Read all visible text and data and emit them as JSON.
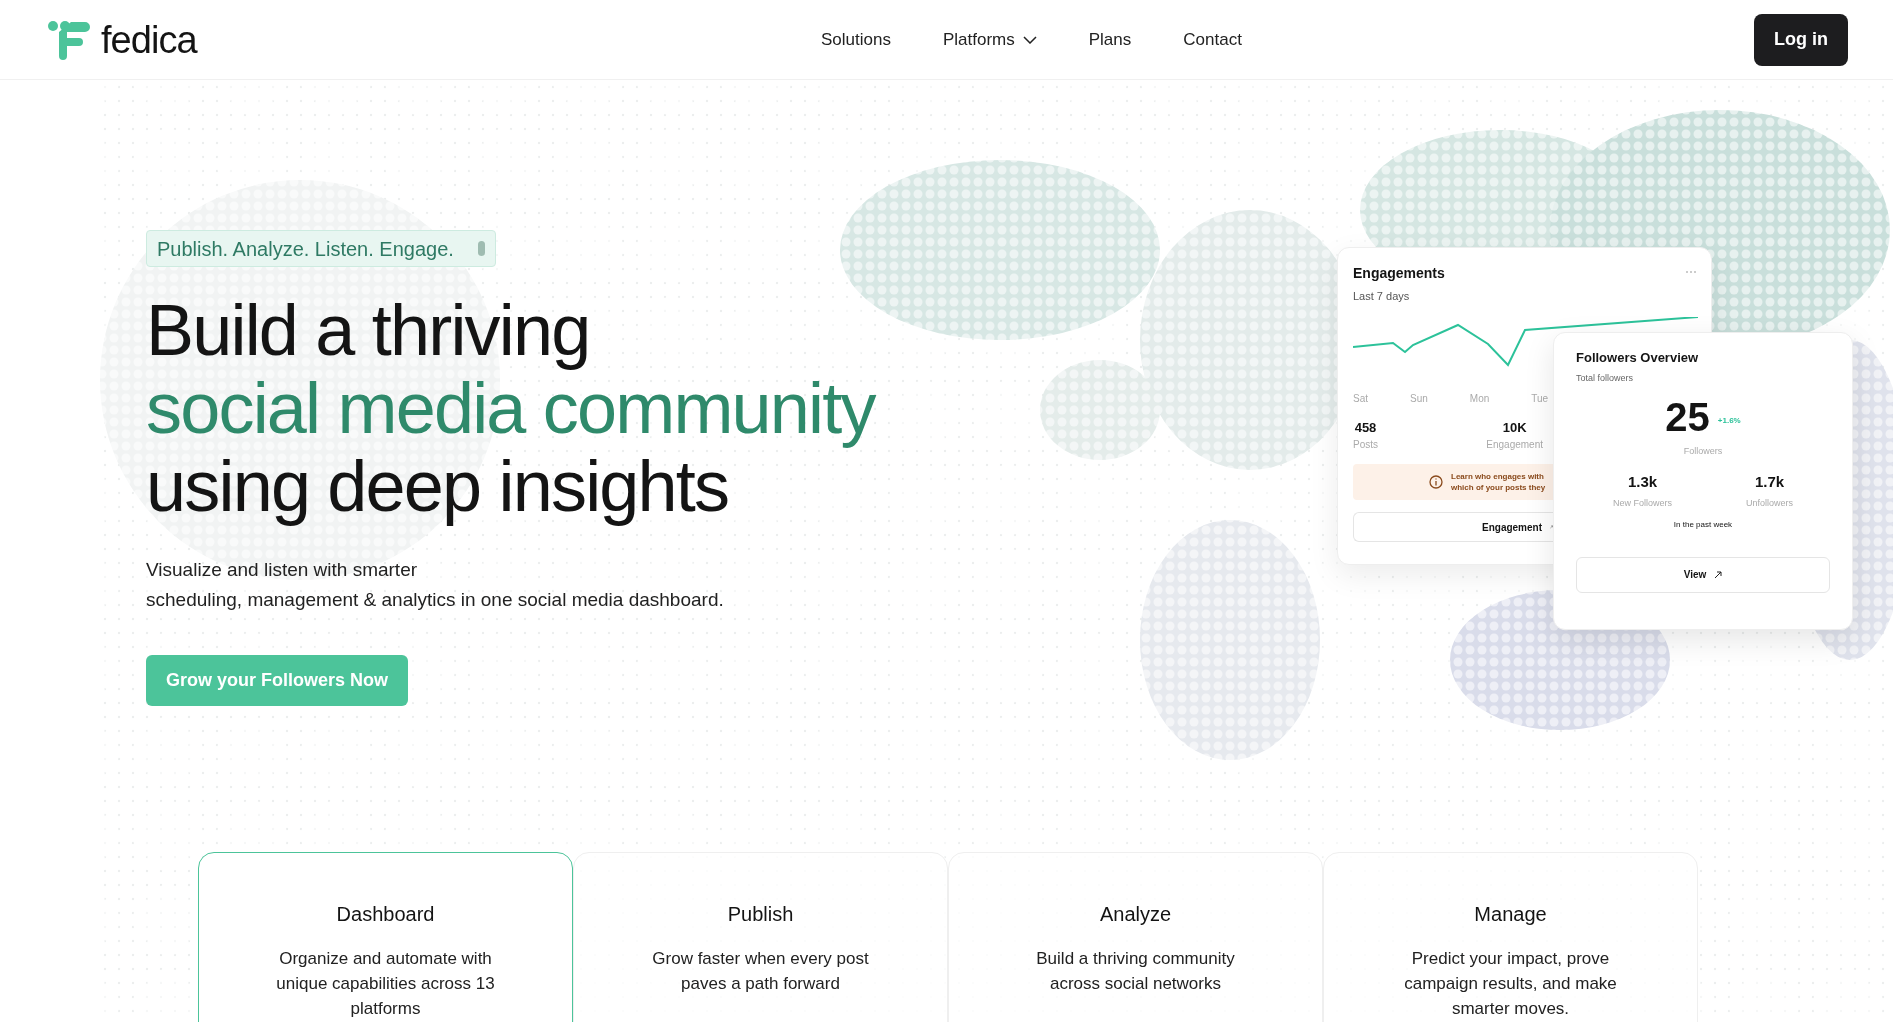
{
  "header": {
    "logo": "fedica",
    "nav": [
      {
        "label": "Solutions",
        "dropdown": false
      },
      {
        "label": "Platforms",
        "dropdown": true
      },
      {
        "label": "Plans",
        "dropdown": false
      },
      {
        "label": "Contact",
        "dropdown": false
      }
    ],
    "login": "Log in"
  },
  "hero": {
    "tagline": "Publish. Analyze. Listen. Engage.",
    "headline": [
      {
        "text": "Build a thriving",
        "accent": false
      },
      {
        "text": "social media community",
        "accent": true
      },
      {
        "text": "using deep insights",
        "accent": false
      }
    ],
    "subtitle": [
      "Visualize and listen with smarter",
      "scheduling, management & analytics in one social media dashboard."
    ],
    "cta": "Grow your Followers Now"
  },
  "engagements_card": {
    "title": "Engagements",
    "subtitle": "Last 7 days",
    "days": [
      "Sat",
      "Sun",
      "Mon",
      "Tue"
    ],
    "stats": [
      {
        "value": "458",
        "label": "Posts"
      },
      {
        "value": "10K",
        "label": "Engagement"
      }
    ],
    "note": [
      "Learn who engages with",
      "which of your posts they"
    ],
    "button": "Engagement"
  },
  "followers_card": {
    "title": "Followers Overview",
    "subtitle": "Total followers",
    "total": "25",
    "change": "+1.6%",
    "total_label": "Followers",
    "stats": [
      {
        "value": "1.3k",
        "label": "New Followers"
      },
      {
        "value": "1.7k",
        "label": "Unfollowers"
      }
    ],
    "period": "In the past week",
    "button": "View"
  },
  "features": [
    {
      "title": "Dashboard",
      "description": "Organize and automate with unique capabilities across 13 platforms",
      "selected": true
    },
    {
      "title": "Publish",
      "description": "Grow faster when every post paves a path forward",
      "selected": false
    },
    {
      "title": "Analyze",
      "description": "Build a thriving community across social networks",
      "selected": false
    },
    {
      "title": "Manage",
      "description": "Predict your impact, prove campaign results, and make smarter moves.",
      "selected": false
    }
  ]
}
